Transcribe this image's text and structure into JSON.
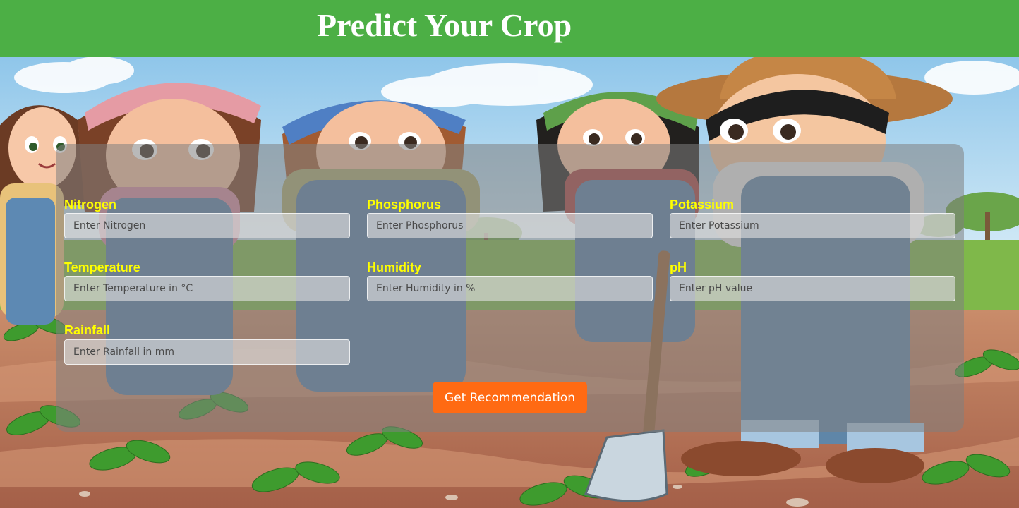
{
  "header": {
    "title": "Predict Your Crop"
  },
  "form": {
    "fields": [
      {
        "label": "Nitrogen",
        "placeholder": "Enter Nitrogen"
      },
      {
        "label": "Phosphorus",
        "placeholder": "Enter Phosphorus"
      },
      {
        "label": "Potassium",
        "placeholder": "Enter Potassium"
      },
      {
        "label": "Temperature",
        "placeholder": "Enter Temperature in °C"
      },
      {
        "label": "Humidity",
        "placeholder": "Enter Humidity in %"
      },
      {
        "label": "pH",
        "placeholder": "Enter pH value"
      },
      {
        "label": "Rainfall",
        "placeholder": "Enter Rainfall in mm"
      }
    ],
    "submit_label": "Get Recommendation"
  },
  "colors": {
    "header_bg": "#4caf45",
    "label": "#ffff00",
    "button": "#ff6a13",
    "sky": "#a7d3ee",
    "soil": "#b5715a",
    "leaf": "#3e9b2e"
  }
}
